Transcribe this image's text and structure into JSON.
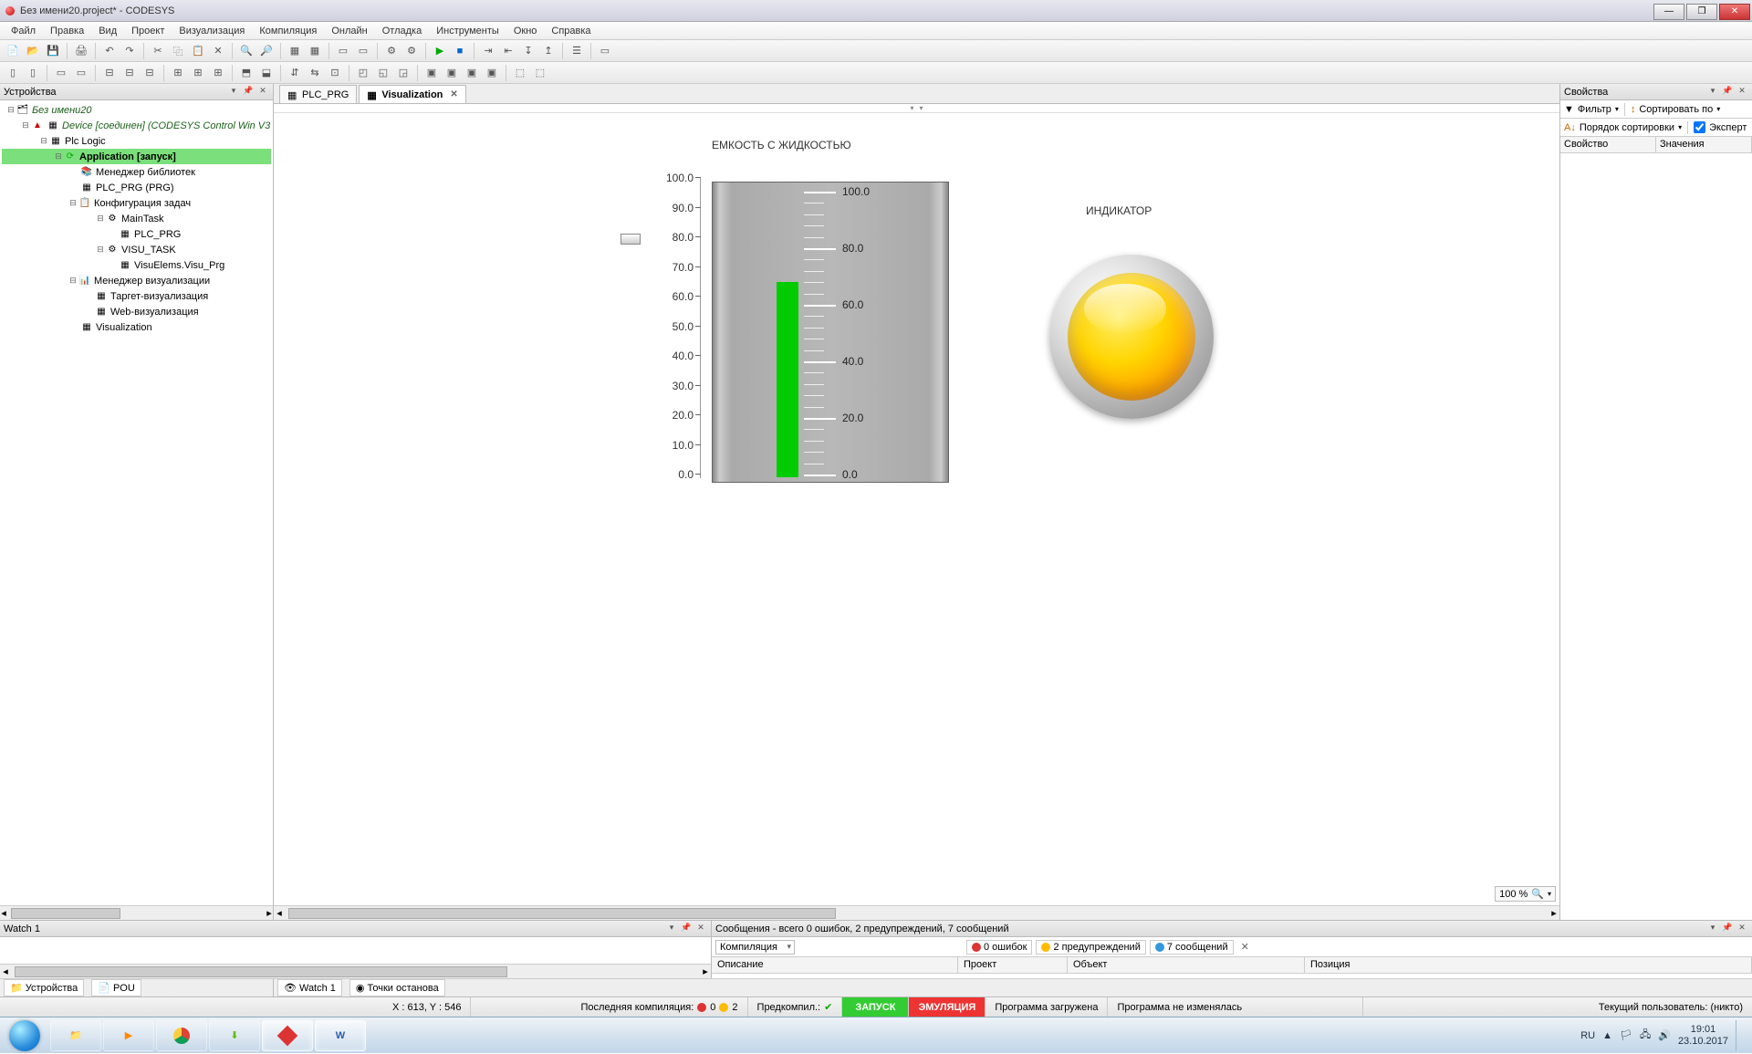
{
  "window": {
    "title": "Без имени20.project* - CODESYS"
  },
  "menu": [
    "Файл",
    "Правка",
    "Вид",
    "Проект",
    "Визуализация",
    "Компиляция",
    "Онлайн",
    "Отладка",
    "Инструменты",
    "Окно",
    "Справка"
  ],
  "panels": {
    "devices": "Устройства",
    "props": "Свойства",
    "watch": "Watch 1",
    "messages_title": "Сообщения - всего 0 ошибок, 2 предупреждений, 7 сообщений"
  },
  "tree": {
    "root": "Без имени20",
    "device": "Device [соединен] (CODESYS Control Win V3",
    "plclogic": "Plc Logic",
    "app": "Application [запуск]",
    "lib": "Менеджер библиотек",
    "plcprg": "PLC_PRG (PRG)",
    "taskcfg": "Конфигурация задач",
    "maintask": "MainTask",
    "plcprg2": "PLC_PRG",
    "visutask": "VISU_TASK",
    "visuelem": "VisuElems.Visu_Prg",
    "vismgr": "Менеджер визуализации",
    "target": "Таргет-визуализация",
    "web": "Web-визуализация",
    "visu": "Visualization"
  },
  "tabs": {
    "plc": "PLC_PRG",
    "visu": "Visualization"
  },
  "canvas": {
    "tank_title": "ЕМКОСТЬ С ЖИДКОСТЬЮ",
    "ind_title": "ИНДИКАТОР",
    "zoom": "100 %",
    "outer_ticks": [
      "100.0",
      "90.0",
      "80.0",
      "70.0",
      "60.0",
      "50.0",
      "40.0",
      "30.0",
      "20.0",
      "10.0",
      "0.0"
    ],
    "tank_ticks": [
      "100.0",
      "80.0",
      "60.0",
      "40.0",
      "20.0",
      "0.0"
    ],
    "fill_percent": 67
  },
  "props": {
    "filter": "Фильтр",
    "sort": "Сортировать по",
    "order": "Порядок сортировки",
    "expert": "Эксперт",
    "col1": "Свойство",
    "col2": "Значения"
  },
  "messages": {
    "combo": "Компиляция",
    "errors": "0 ошибок",
    "warnings": "2 предупреждений",
    "msgs": "7 сообщений",
    "col_desc": "Описание",
    "col_proj": "Проект",
    "col_obj": "Объект",
    "col_pos": "Позиция"
  },
  "bottom_tabs": {
    "dev": "Устройства",
    "pou": "POU",
    "watch": "Watch 1",
    "bp": "Точки останова"
  },
  "status": {
    "coords": "X : 613, Y : 546",
    "lastcomp": "Последняя компиляция:",
    "e": "0",
    "w": "2",
    "precomp": "Предкомпил.:",
    "run": "ЗАПУСК",
    "emu": "ЭМУЛЯЦИЯ",
    "loaded": "Программа загружена",
    "unchanged": "Программа не изменялась",
    "user": "Текущий пользователь: (никто)"
  },
  "tray": {
    "lang": "RU",
    "time": "19:01",
    "date": "23.10.2017"
  }
}
